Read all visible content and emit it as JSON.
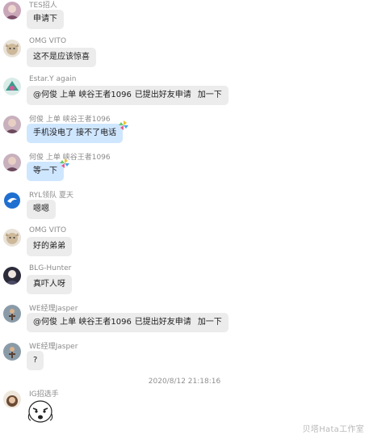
{
  "messages": [
    {
      "sender": "TES招人",
      "text": "申请下"
    },
    {
      "sender": "OMG VITO",
      "text": "这不是应该惊喜"
    },
    {
      "sender": "Estar.Y again",
      "mention": "@何俊 上单 峡谷王者1096",
      "text": "已提出好友申请",
      "text2": "加一下"
    },
    {
      "sender": "何俊 上单 峡谷王者1096",
      "text": "手机没电了 接不了电话"
    },
    {
      "sender": "何俊 上单 峡谷王者1096",
      "text": "等一下"
    },
    {
      "sender": "RYL领队 夏天",
      "text": "嗯嗯"
    },
    {
      "sender": "OMG VITO",
      "text": "好的弟弟"
    },
    {
      "sender": "BLG-Hunter",
      "text": "真吓人呀"
    },
    {
      "sender": "WE经理Jasper",
      "mention": "@何俊 上单 峡谷王者1096",
      "text": "已提出好友申请",
      "text2": "加一下"
    },
    {
      "sender": "WE经理Jasper",
      "text": "?"
    },
    {
      "sender": "IG招选手"
    }
  ],
  "timestamp": "2020/8/12 21:18:16",
  "watermark": "贝塔Hata工作室",
  "colors": {
    "bubble": "#ececec",
    "bubble_self": "#cfe6ff",
    "sender_text": "#8b8b8b"
  }
}
